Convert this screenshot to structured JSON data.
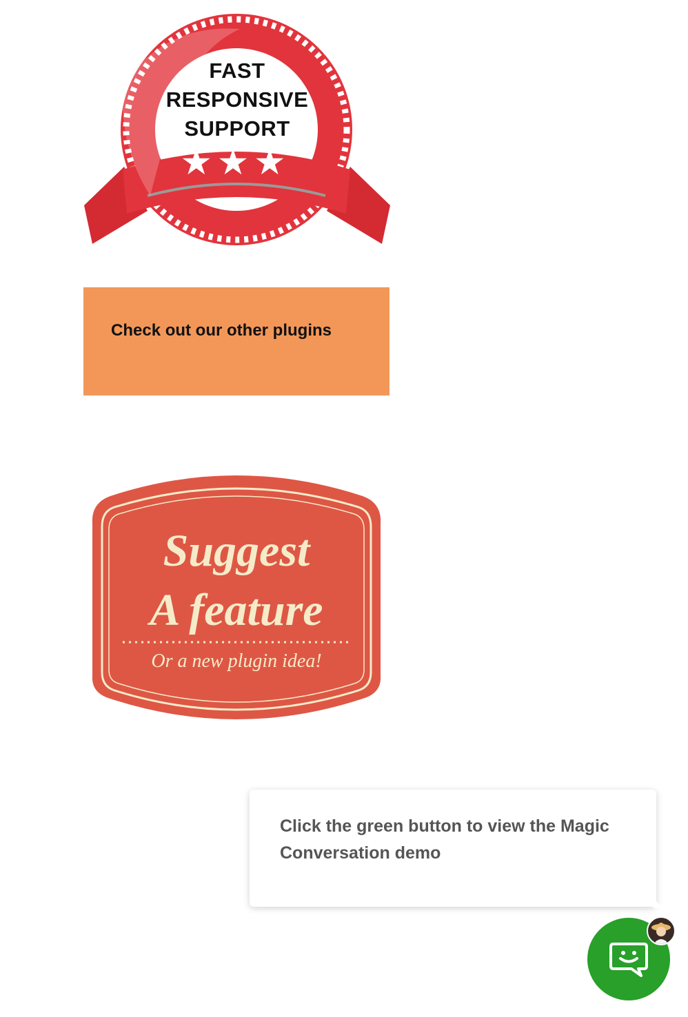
{
  "support_badge": {
    "line1": "FAST",
    "line2": "RESPONSIVE",
    "line3": "SUPPORT",
    "stars": "★★★",
    "colors": {
      "red": "#e2343c",
      "dark_red": "#b8242b",
      "white": "#ffffff"
    }
  },
  "plugins_banner": {
    "label": "Check out our other plugins",
    "color": "#f39758"
  },
  "suggest_badge": {
    "line1": "Suggest",
    "line2": "A feature",
    "line3": "Or a new plugin idea!",
    "colors": {
      "fill": "#de5745",
      "cream": "#f6ebc9"
    }
  },
  "chat": {
    "message": "Click the green button to view the Magic Conversation demo",
    "launcher_color": "#28a02a",
    "launcher_icon": "chat-smile-icon",
    "avatar_icon": "agent-avatar-icon"
  }
}
